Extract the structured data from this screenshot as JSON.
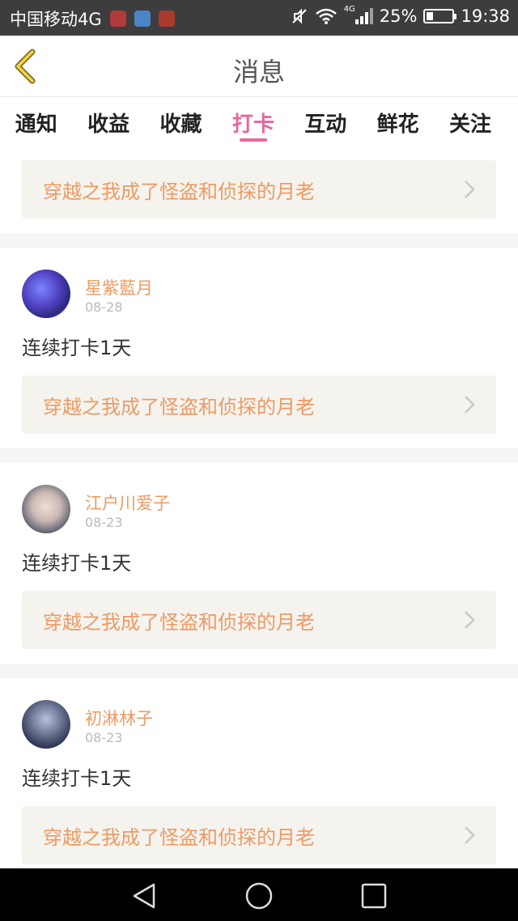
{
  "status_bar": {
    "carrier": "中国移动4G",
    "network_small": "4G",
    "battery": "25%",
    "time": "19:38"
  },
  "header": {
    "title": "消息",
    "back_icon": "chevron-left-icon",
    "accent": "#e8669a"
  },
  "tabs": [
    {
      "label": "通知",
      "active": false
    },
    {
      "label": "收益",
      "active": false
    },
    {
      "label": "收藏",
      "active": false
    },
    {
      "label": "打卡",
      "active": true
    },
    {
      "label": "互动",
      "active": false
    },
    {
      "label": "鲜花",
      "active": false
    },
    {
      "label": "关注",
      "active": false
    }
  ],
  "top_book": {
    "title": "穿越之我成了怪盗和侦探的月老"
  },
  "cards": [
    {
      "user": "星紫藍月",
      "date": "08-28",
      "message": "连续打卡1天",
      "book": "穿越之我成了怪盗和侦探的月老"
    },
    {
      "user": "江户川爱子",
      "date": "08-23",
      "message": "连续打卡1天",
      "book": "穿越之我成了怪盗和侦探的月老"
    },
    {
      "user": "初淋林子",
      "date": "08-23",
      "message": "连续打卡1天",
      "book": "穿越之我成了怪盗和侦探的月老"
    }
  ],
  "colors": {
    "link_text": "#ef9a62",
    "link_bg": "#f4f3ee",
    "status_bg": "#3d3d3d"
  }
}
